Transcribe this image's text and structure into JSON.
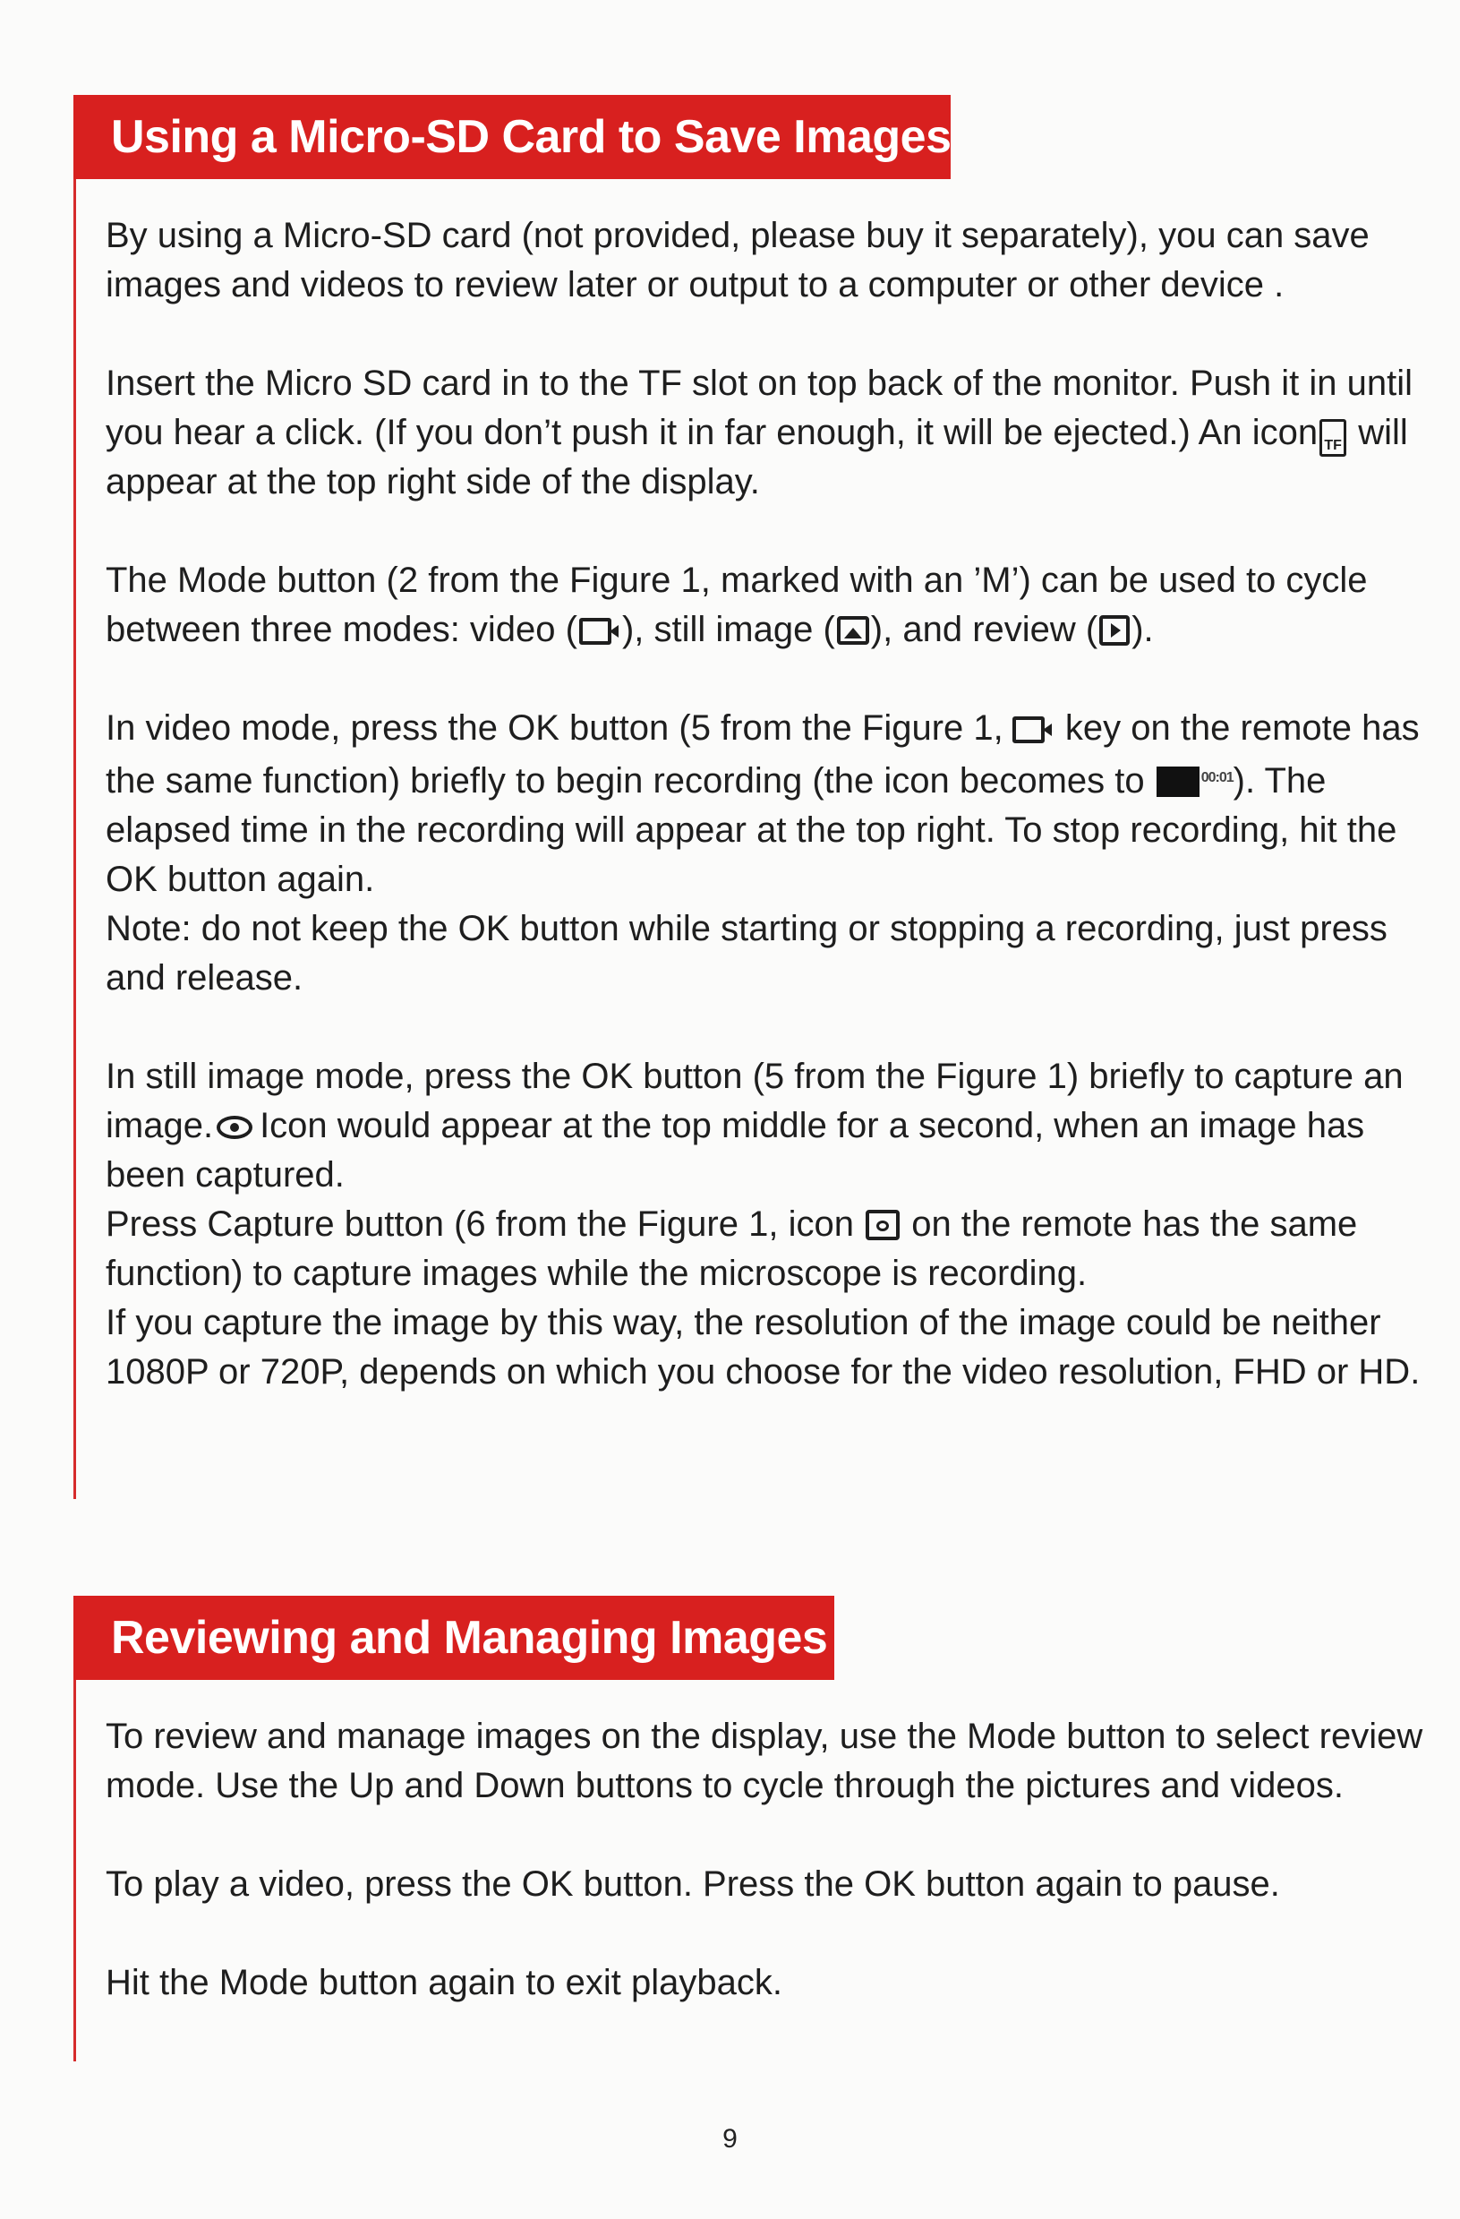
{
  "section1": {
    "title": "Using a Micro-SD Card to Save Images",
    "p1": "By using a Micro-SD card (not provided, please buy it separately), you can save images and videos to review later or output to a computer or other device .",
    "p2a": "Insert the Micro SD card in to the TF slot on top back of the monitor. Push it in until you hear a click. (If you don’t push it in far enough, it will be ejected.) An icon",
    "p2b": " will appear at the top right side of the display.",
    "p3a": "The Mode button (2 from the Figure 1, marked with an ’M’) can be used to cycle between three modes: video (",
    "p3b": "), still image (",
    "p3c": "), and review (",
    "p3d": ").",
    "p4a": "In video mode, press the OK button (5 from the Figure 1,",
    "p4b": " key on the remote has the same function) briefly to begin recording (the icon becomes to ",
    "p4c": "). The elapsed time in the recording will appear at the top right. To stop recording, hit the OK button again.",
    "p4note": "Note: do not keep the OK button while starting or stopping a recording, just press and release.",
    "p5a": "In still image mode, press the OK button (5 from the Figure 1) briefly to capture an image.",
    "p5b": "Icon would appear at the top middle for a second, when an image has been captured.",
    "p6a": "Press Capture button (6 from the Figure 1, icon ",
    "p6b": " on the remote has the same function) to capture images while the microscope is recording.",
    "p7": "If you capture the image by this way, the resolution of the image could be neither 1080P or 720P, depends on which you choose for the video resolution, FHD or HD."
  },
  "section2": {
    "title": "Reviewing and Managing Images",
    "p1": "To review and manage images on the display, use the Mode button to select review mode. Use the Up and Down buttons to cycle through the pictures and videos.",
    "p2": "To play a video, press the OK button. Press the OK button again to pause.",
    "p3": "Hit the Mode button again to exit playback."
  },
  "icons": {
    "tf_card": "tf-card-icon",
    "tf_label": "TF",
    "video": "video-camera-icon",
    "still": "picture-icon",
    "review": "play-icon",
    "recording": "recording-indicator-icon",
    "rec_time": "00:01",
    "eye": "eye-icon",
    "capture": "camera-capture-icon"
  },
  "page_number": "9",
  "colors": {
    "banner": "#d8201f",
    "rule": "#d62b2b",
    "text": "#1e1e1e"
  }
}
